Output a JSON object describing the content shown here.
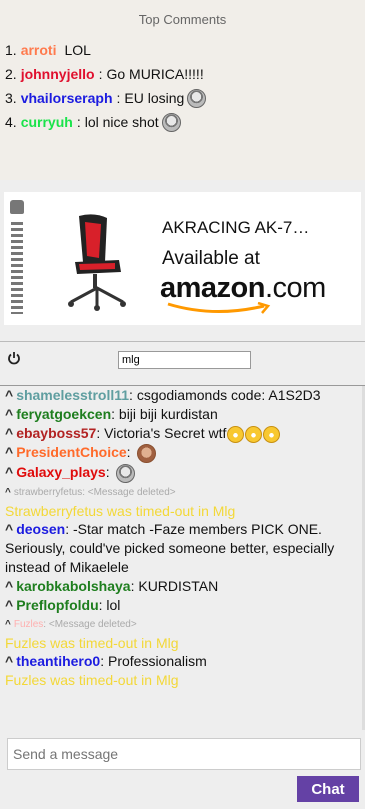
{
  "top_comments": {
    "title": "Top Comments",
    "items": [
      {
        "rank": "1.",
        "user": "arroti",
        "color": "#ff7a4d",
        "sep": "",
        "text": "LOL",
        "emote": ""
      },
      {
        "rank": "2.",
        "user": "johnnyjello",
        "color": "#e0102e",
        "sep": ":",
        "text": "Go MURICA!!!!!",
        "emote": ""
      },
      {
        "rank": "3.",
        "user": "vhailorseraph",
        "color": "#1c1ce0",
        "sep": ":",
        "text": "EU losing",
        "emote": "face"
      },
      {
        "rank": "4.",
        "user": "curryuh",
        "color": "#19e34a",
        "sep": ":",
        "text": "lol nice shot",
        "emote": "face"
      }
    ]
  },
  "ad": {
    "title": "AKRACING AK-7…",
    "available": "Available at",
    "brand": "amazon",
    "tld": ".com"
  },
  "filter": {
    "value": "mlg"
  },
  "chat": {
    "messages": [
      {
        "type": "msg",
        "user": "shamelesstroll11",
        "color": "#5f9ea0",
        "text": "csgodiamonds code: A1S2D3",
        "emote": ""
      },
      {
        "type": "msg",
        "user": "feryatgoekcen",
        "color": "#1e7e1e",
        "text": "biji biji kurdistan",
        "emote": ""
      },
      {
        "type": "msg",
        "user": "ebayboss57",
        "color": "#b22222",
        "text": "Victoria's Secret wtf",
        "emote": "laugh3"
      },
      {
        "type": "msg",
        "user": "PresidentChoice",
        "color": "#ff6a2a",
        "text": "",
        "emote": "kappa"
      },
      {
        "type": "msg",
        "user": "Galaxy_plays",
        "color": "#e00b0b",
        "text": "",
        "emote": "face"
      },
      {
        "type": "deleted",
        "user": "strawberryfetus",
        "color": "#aaaaaa",
        "text": "<Message deleted>"
      },
      {
        "type": "timeout",
        "text": "Strawberryfetus was timed-out in Mlg"
      },
      {
        "type": "msg",
        "user": "deosen",
        "color": "#1c1ce0",
        "text": "-Star match -Faze members PICK ONE. Seriously, could've picked someone better, especially instead of Mikaelele",
        "emote": ""
      },
      {
        "type": "msg",
        "user": "karobkabolshaya",
        "color": "#1e7e1e",
        "text": "KURDISTAN",
        "emote": ""
      },
      {
        "type": "msg",
        "user": "Preflopfoldu",
        "color": "#1e7e1e",
        "text": "lol",
        "emote": ""
      },
      {
        "type": "deleted",
        "user": "Fuzles",
        "color": "#ffb0b0",
        "text": "<Message deleted>"
      },
      {
        "type": "timeout",
        "text": "Fuzles was timed-out in Mlg"
      },
      {
        "type": "msg",
        "user": "theantihero0",
        "color": "#1c1ce0",
        "text": "Professionalism",
        "emote": ""
      },
      {
        "type": "timeout",
        "text": "Fuzles was timed-out in Mlg"
      }
    ]
  },
  "input": {
    "placeholder": "Send a message",
    "button": "Chat"
  },
  "colors": {
    "accent": "#6441a5",
    "timeout": "#f3d838"
  }
}
